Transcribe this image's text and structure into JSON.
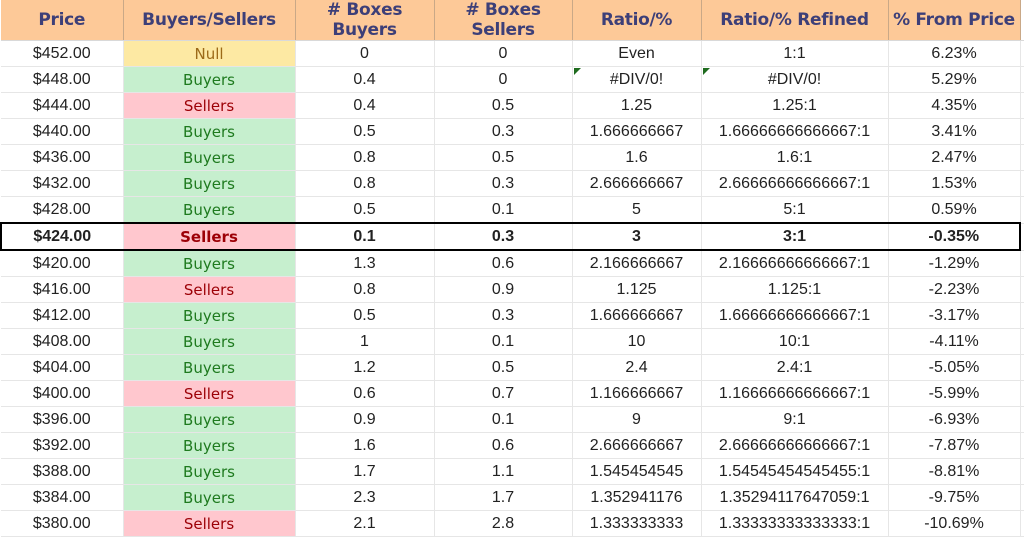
{
  "headers": [
    "Price",
    "Buyers/Sellers",
    "# Boxes Buyers",
    "# Boxes Sellers",
    "Ratio/%",
    "Ratio/% Refined",
    "% From Price"
  ],
  "colors": {
    "header_bg": "#fdc998",
    "header_text": "#3d3f78",
    "null_bg": "#fde9a3",
    "null_text": "#9c6a18",
    "buyers_bg": "#c6efce",
    "buyers_text": "#1e7a1e",
    "sellers_bg": "#ffc7ce",
    "sellers_text": "#9c0006",
    "error_flag": "#1e6b1e"
  },
  "highlighted_row_index": 7,
  "rows": [
    {
      "price": "$452.00",
      "side": "Null",
      "boxes_buyers": "0",
      "boxes_sellers": "0",
      "ratio": "Even",
      "ratio_refined": "1:1",
      "from_price": "6.23%"
    },
    {
      "price": "$448.00",
      "side": "Buyers",
      "boxes_buyers": "0.4",
      "boxes_sellers": "0",
      "ratio": "#DIV/0!",
      "ratio_refined": "#DIV/0!",
      "from_price": "5.29%",
      "error_flags": true
    },
    {
      "price": "$444.00",
      "side": "Sellers",
      "boxes_buyers": "0.4",
      "boxes_sellers": "0.5",
      "ratio": "1.25",
      "ratio_refined": "1.25:1",
      "from_price": "4.35%"
    },
    {
      "price": "$440.00",
      "side": "Buyers",
      "boxes_buyers": "0.5",
      "boxes_sellers": "0.3",
      "ratio": "1.666666667",
      "ratio_refined": "1.66666666666667:1",
      "from_price": "3.41%"
    },
    {
      "price": "$436.00",
      "side": "Buyers",
      "boxes_buyers": "0.8",
      "boxes_sellers": "0.5",
      "ratio": "1.6",
      "ratio_refined": "1.6:1",
      "from_price": "2.47%"
    },
    {
      "price": "$432.00",
      "side": "Buyers",
      "boxes_buyers": "0.8",
      "boxes_sellers": "0.3",
      "ratio": "2.666666667",
      "ratio_refined": "2.66666666666667:1",
      "from_price": "1.53%"
    },
    {
      "price": "$428.00",
      "side": "Buyers",
      "boxes_buyers": "0.5",
      "boxes_sellers": "0.1",
      "ratio": "5",
      "ratio_refined": "5:1",
      "from_price": "0.59%"
    },
    {
      "price": "$424.00",
      "side": "Sellers",
      "boxes_buyers": "0.1",
      "boxes_sellers": "0.3",
      "ratio": "3",
      "ratio_refined": "3:1",
      "from_price": "-0.35%"
    },
    {
      "price": "$420.00",
      "side": "Buyers",
      "boxes_buyers": "1.3",
      "boxes_sellers": "0.6",
      "ratio": "2.166666667",
      "ratio_refined": "2.16666666666667:1",
      "from_price": "-1.29%"
    },
    {
      "price": "$416.00",
      "side": "Sellers",
      "boxes_buyers": "0.8",
      "boxes_sellers": "0.9",
      "ratio": "1.125",
      "ratio_refined": "1.125:1",
      "from_price": "-2.23%"
    },
    {
      "price": "$412.00",
      "side": "Buyers",
      "boxes_buyers": "0.5",
      "boxes_sellers": "0.3",
      "ratio": "1.666666667",
      "ratio_refined": "1.66666666666667:1",
      "from_price": "-3.17%"
    },
    {
      "price": "$408.00",
      "side": "Buyers",
      "boxes_buyers": "1",
      "boxes_sellers": "0.1",
      "ratio": "10",
      "ratio_refined": "10:1",
      "from_price": "-4.11%"
    },
    {
      "price": "$404.00",
      "side": "Buyers",
      "boxes_buyers": "1.2",
      "boxes_sellers": "0.5",
      "ratio": "2.4",
      "ratio_refined": "2.4:1",
      "from_price": "-5.05%"
    },
    {
      "price": "$400.00",
      "side": "Sellers",
      "boxes_buyers": "0.6",
      "boxes_sellers": "0.7",
      "ratio": "1.166666667",
      "ratio_refined": "1.16666666666667:1",
      "from_price": "-5.99%"
    },
    {
      "price": "$396.00",
      "side": "Buyers",
      "boxes_buyers": "0.9",
      "boxes_sellers": "0.1",
      "ratio": "9",
      "ratio_refined": "9:1",
      "from_price": "-6.93%"
    },
    {
      "price": "$392.00",
      "side": "Buyers",
      "boxes_buyers": "1.6",
      "boxes_sellers": "0.6",
      "ratio": "2.666666667",
      "ratio_refined": "2.66666666666667:1",
      "from_price": "-7.87%"
    },
    {
      "price": "$388.00",
      "side": "Buyers",
      "boxes_buyers": "1.7",
      "boxes_sellers": "1.1",
      "ratio": "1.545454545",
      "ratio_refined": "1.54545454545455:1",
      "from_price": "-8.81%"
    },
    {
      "price": "$384.00",
      "side": "Buyers",
      "boxes_buyers": "2.3",
      "boxes_sellers": "1.7",
      "ratio": "1.352941176",
      "ratio_refined": "1.35294117647059:1",
      "from_price": "-9.75%"
    },
    {
      "price": "$380.00",
      "side": "Sellers",
      "boxes_buyers": "2.1",
      "boxes_sellers": "2.8",
      "ratio": "1.333333333",
      "ratio_refined": "1.33333333333333:1",
      "from_price": "-10.69%"
    }
  ]
}
